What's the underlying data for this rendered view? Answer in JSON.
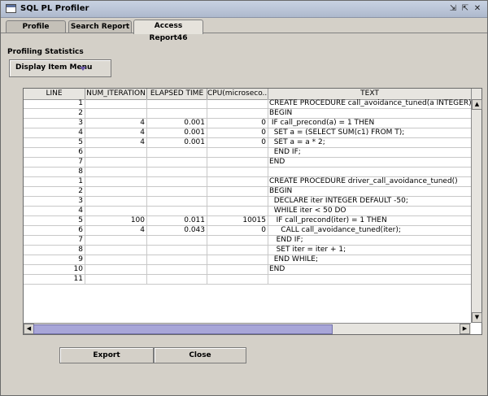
{
  "window": {
    "title": "SQL PL Profiler",
    "controls": [
      "restore-icon",
      "maximize-icon",
      "close-icon"
    ]
  },
  "tabs": [
    {
      "label": "Profile Setting",
      "active": false
    },
    {
      "label": "Search Report",
      "active": false
    },
    {
      "label": "Access Report46",
      "active": true
    }
  ],
  "statistics": {
    "section_label": "Profiling Statistics",
    "menu_label": "Display Item Menu"
  },
  "table": {
    "columns": [
      "LINE",
      "NUM_ITERATION",
      "ELAPSED TIME",
      "CPU(microseco...",
      "TEXT"
    ],
    "rows": [
      [
        "1",
        "",
        "",
        "",
        "CREATE PROCEDURE call_avoidance_tuned(a INTEGER)"
      ],
      [
        "2",
        "",
        "",
        "",
        "BEGIN"
      ],
      [
        "3",
        "4",
        "0.001",
        "0",
        " IF call_precond(a) = 1 THEN"
      ],
      [
        "4",
        "4",
        "0.001",
        "0",
        "  SET a = (SELECT SUM(c1) FROM T);"
      ],
      [
        "5",
        "4",
        "0.001",
        "0",
        "  SET a = a * 2;"
      ],
      [
        "6",
        "",
        "",
        "",
        "  END IF;"
      ],
      [
        "7",
        "",
        "",
        "",
        "END"
      ],
      [
        "8",
        "",
        "",
        "",
        ""
      ],
      [
        "1",
        "",
        "",
        "",
        "CREATE PROCEDURE driver_call_avoidance_tuned()"
      ],
      [
        "2",
        "",
        "",
        "",
        "BEGIN"
      ],
      [
        "3",
        "",
        "",
        "",
        "  DECLARE iter INTEGER DEFAULT -50;"
      ],
      [
        "4",
        "",
        "",
        "",
        "  WHILE iter < 50 DO"
      ],
      [
        "5",
        "100",
        "0.011",
        "10015",
        "   IF call_precond(iter) = 1 THEN"
      ],
      [
        "6",
        "4",
        "0.043",
        "0",
        "     CALL call_avoidance_tuned(iter);"
      ],
      [
        "7",
        "",
        "",
        "",
        "   END IF;"
      ],
      [
        "8",
        "",
        "",
        "",
        "   SET iter = iter + 1;"
      ],
      [
        "9",
        "",
        "",
        "",
        "  END WHILE;"
      ],
      [
        "10",
        "",
        "",
        "",
        "END"
      ],
      [
        "11",
        "",
        "",
        "",
        ""
      ]
    ]
  },
  "buttons": {
    "export_label": "Export",
    "close_label": "Close"
  },
  "colors": {
    "background": "#d4d0c8",
    "accent": "#a8a6d8"
  }
}
